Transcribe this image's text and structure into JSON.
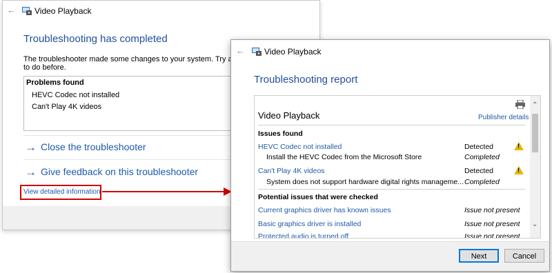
{
  "left_window": {
    "title": "Video Playback",
    "heading": "Troubleshooting has completed",
    "message_line1": "The troubleshooter made some changes to your system. Try attempting",
    "message_line2": "to do before.",
    "problems_header": "Problems found",
    "problems": [
      "HEVC Codec not installed",
      "Can't Play 4K videos"
    ],
    "actions": [
      "Close the troubleshooter",
      "Give feedback on this troubleshooter"
    ],
    "detail_link": "View detailed information"
  },
  "right_window": {
    "title": "Video Playback",
    "heading": "Troubleshooting report",
    "report_title": "Video Playback",
    "publisher_link": "Publisher details",
    "issues_header": "Issues found",
    "issues": [
      {
        "name": "HEVC Codec not installed",
        "status": "Detected",
        "fix": "Install the HEVC Codec from the Microsoft Store",
        "fix_status": "Completed"
      },
      {
        "name": "Can't Play 4K videos",
        "status": "Detected",
        "fix": "System does not support hardware digital rights manageme...",
        "fix_status": "Completed"
      }
    ],
    "potential_header": "Potential issues that were checked",
    "potential": [
      {
        "name": "Current graphics driver has known issues",
        "status": "Issue not present"
      },
      {
        "name": "Basic graphics driver is installed",
        "status": "Issue not present"
      },
      {
        "name": "Protected audio is turned off",
        "status": "Issue not present"
      }
    ],
    "buttons": {
      "next": "Next",
      "cancel": "Cancel"
    }
  },
  "colors": {
    "link": "#1e5aa8",
    "heading": "#1f4e9a",
    "callout": "#d00000",
    "warning": "#e6b800"
  }
}
